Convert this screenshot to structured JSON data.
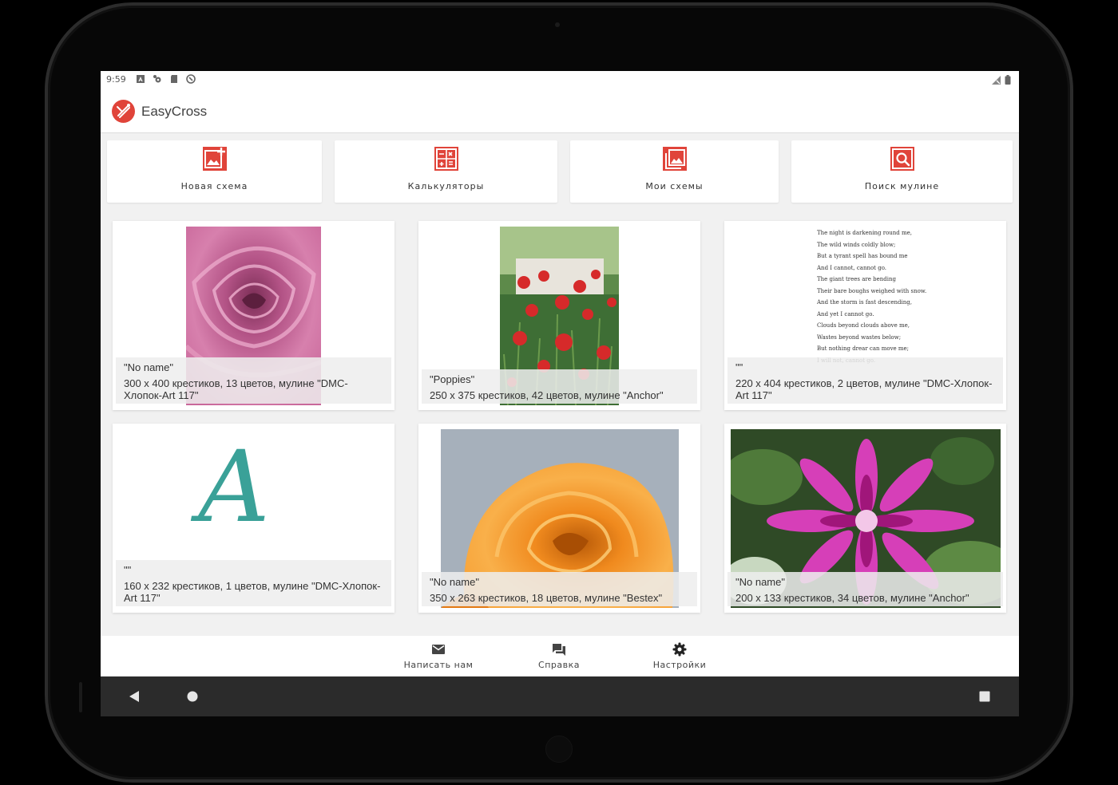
{
  "status_bar": {
    "time": "9:59"
  },
  "app": {
    "title": "EasyCross",
    "brand_color": "#e0443a"
  },
  "actions": [
    {
      "label": "Новая схема",
      "icon": "add-image-icon"
    },
    {
      "label": "Калькуляторы",
      "icon": "calculator-icon"
    },
    {
      "label": "Мои схемы",
      "icon": "gallery-icon"
    },
    {
      "label": "Поиск мулине",
      "icon": "search-icon"
    }
  ],
  "patterns": [
    {
      "name": "\"No name\"",
      "details": "300 x 400 крестиков, 13 цветов, мулине \"DMC-Хлопок-Art 117\"",
      "image": "pink-rose"
    },
    {
      "name": "\"Poppies\"",
      "details": "250 x 375 крестиков, 42 цветов, мулине \"Anchor\"",
      "image": "poppies"
    },
    {
      "name": "\"\"",
      "details": "220 x 404 крестиков, 2 цветов, мулине \"DMC-Хлопок-Art 117\"",
      "image": "poem-text"
    },
    {
      "name": "\"\"",
      "details": "160 x 232 крестиков, 1 цветов, мулине \"DMC-Хлопок-Art 117\"",
      "image": "letter-a"
    },
    {
      "name": "\"No name\"",
      "details": "350 x 263 крестиков, 18 цветов, мулине \"Bestex\"",
      "image": "orange-rose"
    },
    {
      "name": "\"No name\"",
      "details": "200 x 133 крестиков, 34 цветов, мулине \"Anchor\"",
      "image": "dahlia"
    }
  ],
  "poem": {
    "lines": [
      "The night is darkening round me,",
      "The wild winds coldly blow;",
      "But a tyrant spell has bound me",
      "And I cannot, cannot go.",
      "The giant trees are bending",
      "Their bare boughs weighed with snow.",
      "And the storm is fast descending,",
      "And yet I cannot go.",
      "Clouds beyond clouds above me,",
      "Wastes beyond wastes below;",
      "But nothing drear can move me;",
      "I will not, cannot go."
    ]
  },
  "letter_glyph": "A",
  "bottom_nav": [
    {
      "label": "Написать нам",
      "icon": "mail-icon"
    },
    {
      "label": "Справка",
      "icon": "forum-icon"
    },
    {
      "label": "Настройки",
      "icon": "settings-icon"
    }
  ]
}
